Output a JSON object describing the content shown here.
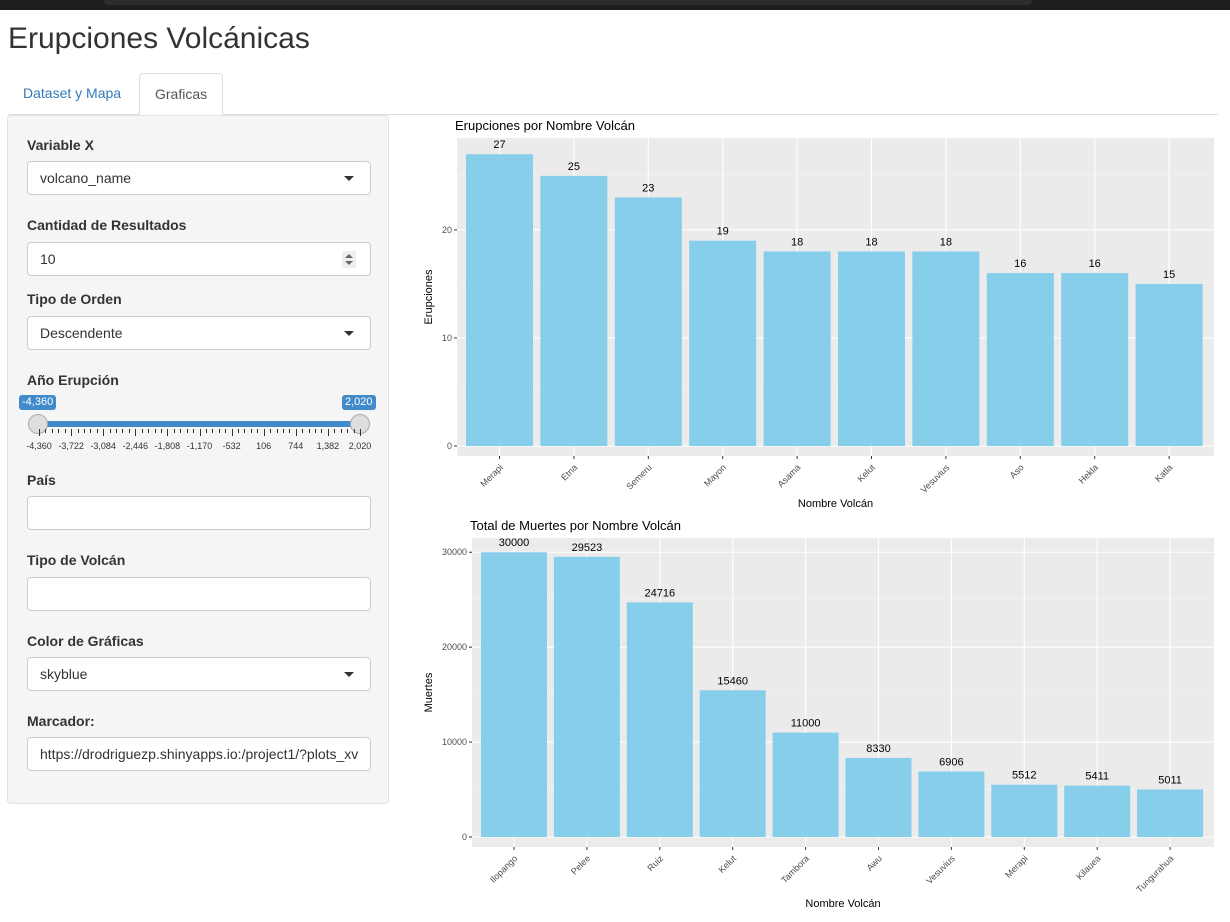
{
  "app": {
    "title": "Erupciones Volcánicas"
  },
  "tabs": [
    {
      "label": "Dataset y Mapa",
      "active": false
    },
    {
      "label": "Graficas",
      "active": true
    }
  ],
  "sidebar": {
    "variable_x": {
      "label": "Variable X",
      "value": "volcano_name"
    },
    "cantidad": {
      "label": "Cantidad de Resultados",
      "value": "10"
    },
    "orden": {
      "label": "Tipo de Orden",
      "value": "Descendente"
    },
    "anio": {
      "label": "Año Erupción",
      "min_badge": "-4,360",
      "max_badge": "2,020",
      "range": [
        -4360,
        2020
      ],
      "ticks": [
        "-4,360",
        "-3,722",
        "-3,084",
        "-2,446",
        "-1,808",
        "-1,170",
        "-532",
        "106",
        "744",
        "1,382",
        "2,020"
      ]
    },
    "pais": {
      "label": "País",
      "value": ""
    },
    "tipo_volcan": {
      "label": "Tipo de Volcán",
      "value": ""
    },
    "color": {
      "label": "Color de Gráficas",
      "value": "skyblue"
    },
    "marcador": {
      "label": "Marcador:",
      "value": "https://drodriguezp.shinyapps.io:/project1/?plots_xv"
    }
  },
  "colors": {
    "bar": "#87CEEB",
    "panel": "#EBEBEB",
    "accent": "#428bca",
    "link": "#337ab7"
  },
  "chart_data": [
    {
      "type": "bar",
      "title": "Erupciones por Nombre Volcán",
      "xlabel": "Nombre Volcán",
      "ylabel": "Erupciones",
      "categories": [
        "Merapi",
        "Etna",
        "Semeru",
        "Mayon",
        "Asama",
        "Kelut",
        "Vesuvius",
        "Aso",
        "Hekla",
        "Katla"
      ],
      "values": [
        27,
        25,
        23,
        19,
        18,
        18,
        18,
        16,
        16,
        15
      ],
      "yticks": [
        0,
        10,
        20
      ],
      "ylim": [
        0,
        28.5
      ],
      "grid": true
    },
    {
      "type": "bar",
      "title": "Total de Muertes por Nombre Volcán",
      "xlabel": "Nombre Volcán",
      "ylabel": "Muertes",
      "categories": [
        "Ilopango",
        "Pelee",
        "Ruiz",
        "Kelut",
        "Tambora",
        "Awu",
        "Vesuvius",
        "Merapi",
        "Kilauea",
        "Tungurahua"
      ],
      "values": [
        30000,
        29523,
        24716,
        15460,
        11000,
        8330,
        6906,
        5512,
        5411,
        5011
      ],
      "yticks": [
        0,
        10000,
        20000,
        30000
      ],
      "ylim": [
        0,
        31500
      ],
      "grid": true
    }
  ]
}
